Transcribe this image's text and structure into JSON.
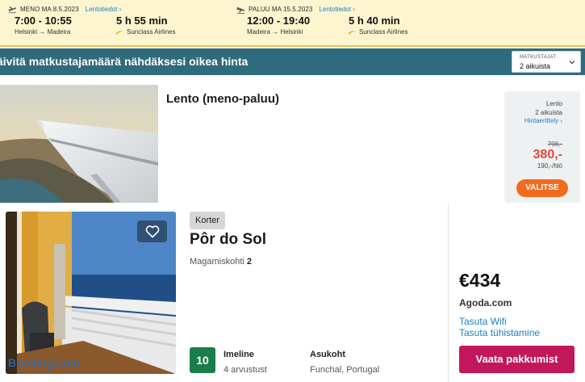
{
  "outbound": {
    "date_label": "MENO MA 8.5.2023",
    "info_link": "Lentotiedot",
    "times": "7:00 - 10:55",
    "route": "Helsinki → Madeira",
    "duration": "5 h 55 min",
    "airline": "Sunclass Airlines"
  },
  "return": {
    "date_label": "PALUU MA 15.5.2023",
    "info_link": "Lentotiedot",
    "times": "12:00 - 19:40",
    "route": "Madeira → Helsinki",
    "duration": "5 h 40 min",
    "airline": "Sunclass Airlines"
  },
  "banner": {
    "text": "äivitä matkustajamäärä nähdäksesi oikea hinta",
    "traveller_label": "MATKUSTAJAT",
    "traveller_value": "2 aikuista"
  },
  "flight_card": {
    "title": "Lento (meno-paluu)",
    "price_label": "Lento",
    "travellers": "2 aikuista",
    "breakdown_link": "Hintaerittely",
    "old_price": "798,-",
    "price": "380,-",
    "per_person": "190,-/hlö",
    "select_label": "VALITSE"
  },
  "hotel_card": {
    "type_badge": "Korter",
    "name": "Pôr do Sol",
    "beds_label": "Magamiskohti",
    "beds_count": "2",
    "photo_watermark": "Booking.com",
    "score": "10",
    "rating_word": "Imeline",
    "review_count": "4 arvustust",
    "location_label": "Asukoht",
    "location_value": "Funchal, Portugal",
    "price": "€434",
    "provider": "Agoda.com",
    "perks": [
      "Tasuta Wifi",
      "Tasuta tühistamine"
    ],
    "deal_button": "Vaata pakkumist"
  },
  "colors": {
    "strip_bg": "#fdf5cf",
    "banner_bg": "#2f6b7c",
    "select_button": "#f26a1b",
    "price_red": "#e5473a",
    "score_green": "#1a7d4a",
    "deal_button": "#c2185b",
    "link_blue": "#1a7fc1"
  },
  "icons": {
    "outbound_plane": "plane-takeoff-icon",
    "return_plane": "plane-landing-icon",
    "airline": "airline-logo-icon",
    "chevron": "chevron-down-icon",
    "favorite": "heart-icon"
  }
}
